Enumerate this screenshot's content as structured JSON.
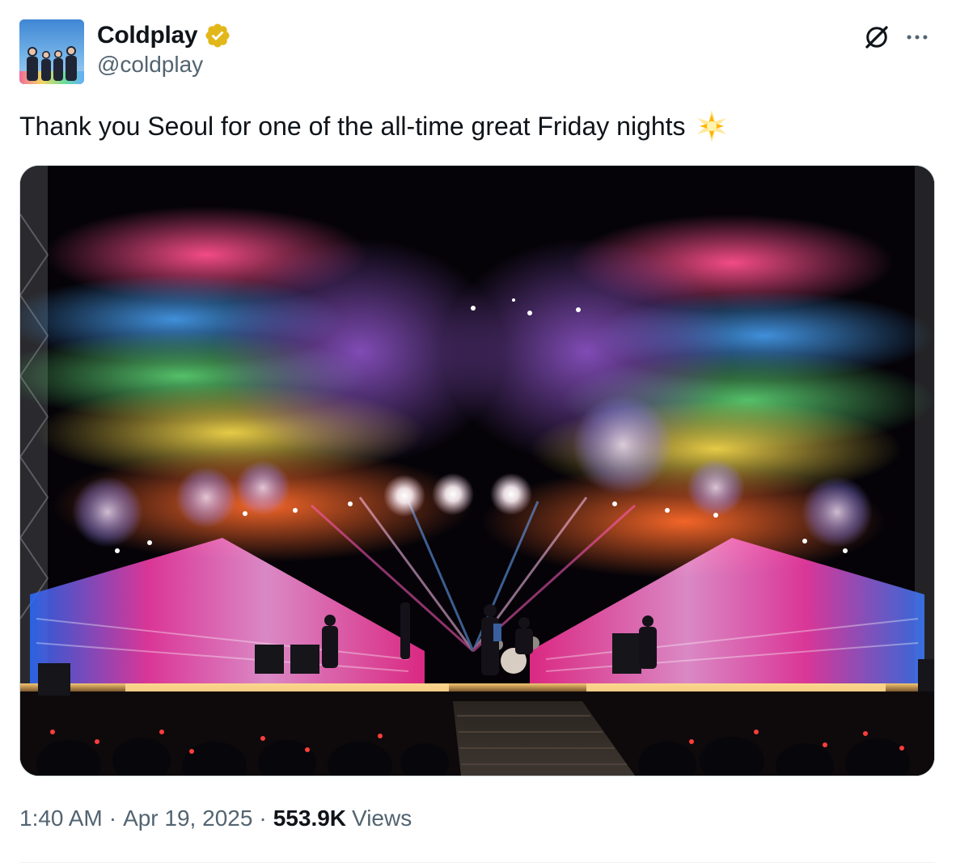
{
  "author": {
    "display_name": "Coldplay",
    "handle": "@coldplay",
    "verified": true
  },
  "icons": {
    "verified": "verified-badge-icon",
    "grok": "grok-icon",
    "more": "more-options-icon",
    "emoji": "glowing-star-emoji"
  },
  "tweet": {
    "text": "Thank you Seoul for one of the all-time great Friday nights",
    "emoji": "🌟"
  },
  "meta": {
    "time": "1:40 AM",
    "separator": "·",
    "date": "Apr 19, 2025",
    "views_count": "553.9K",
    "views_label": "Views"
  },
  "colors": {
    "text_primary": "#0f1419",
    "text_secondary": "#536471",
    "verified_gold": "#e2b719",
    "border": "#cfd9de"
  }
}
